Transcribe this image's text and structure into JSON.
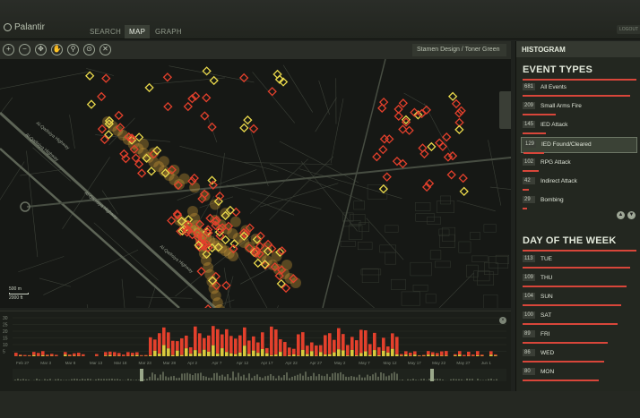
{
  "app": {
    "logo": "Palantir",
    "logout": "LOGOUT"
  },
  "nav": {
    "tabs": [
      "SEARCH",
      "MAP",
      "GRAPH"
    ],
    "active": "MAP"
  },
  "map": {
    "tools": [
      "zoom-in",
      "zoom-out",
      "select",
      "pan",
      "pin",
      "measure",
      "close"
    ],
    "tool_glyphs": [
      "+",
      "−",
      "✥",
      "✋",
      "⚲",
      "⊙",
      "✕"
    ],
    "basemap_label": "Stamen Design / Toner Green",
    "scale": {
      "top": "500 m",
      "bottom": "2000 ft"
    },
    "road_labels": [
      "Al-Qadisiya Highway",
      "Al-Qadisiya Highway",
      "Al-Qadisiya Highway",
      "Al-Qadisiya Highway"
    ],
    "colors": {
      "event_red": "#e3402c",
      "event_yellow": "#e9d84b",
      "heat": "#f5b640"
    }
  },
  "panel": {
    "header": "HISTOGRAM",
    "event_types_title": "EVENT TYPES",
    "event_types": [
      {
        "count": "681",
        "label": "All Events",
        "value": 681
      },
      {
        "count": "209",
        "label": "Small Arms Fire",
        "value": 209
      },
      {
        "count": "145",
        "label": "IED Attack",
        "value": 145
      },
      {
        "count": "129",
        "label": "IED Found/Cleared",
        "value": 129,
        "selected": true
      },
      {
        "count": "102",
        "label": "RPG Attack",
        "value": 102
      },
      {
        "count": "42",
        "label": "Indirect Attack",
        "value": 42
      },
      {
        "count": "29",
        "label": "Bombing",
        "value": 29
      }
    ],
    "days_title": "DAY OF THE WEEK",
    "days": [
      {
        "count": "113",
        "label": "TUE",
        "value": 113
      },
      {
        "count": "109",
        "label": "THU",
        "value": 109
      },
      {
        "count": "104",
        "label": "SUN",
        "value": 104
      },
      {
        "count": "100",
        "label": "SAT",
        "value": 100
      },
      {
        "count": "89",
        "label": "FRI",
        "value": 89
      },
      {
        "count": "86",
        "label": "WED",
        "value": 86
      },
      {
        "count": "80",
        "label": "MON",
        "value": 80
      }
    ]
  },
  "timeline": {
    "y_ticks": [
      "30",
      "25",
      "20",
      "15",
      "10",
      "5"
    ],
    "x_labels": [
      "Feb 27",
      "Mar 3",
      "Mar 8",
      "Mar 13",
      "Mar 18",
      "Mar 23",
      "Mar 28",
      "Apr 2",
      "Apr 7",
      "Apr 12",
      "Apr 17",
      "Apr 22",
      "Apr 27",
      "May 2",
      "May 7",
      "May 12",
      "May 17",
      "May 22",
      "May 27",
      "Jun 1"
    ]
  }
}
